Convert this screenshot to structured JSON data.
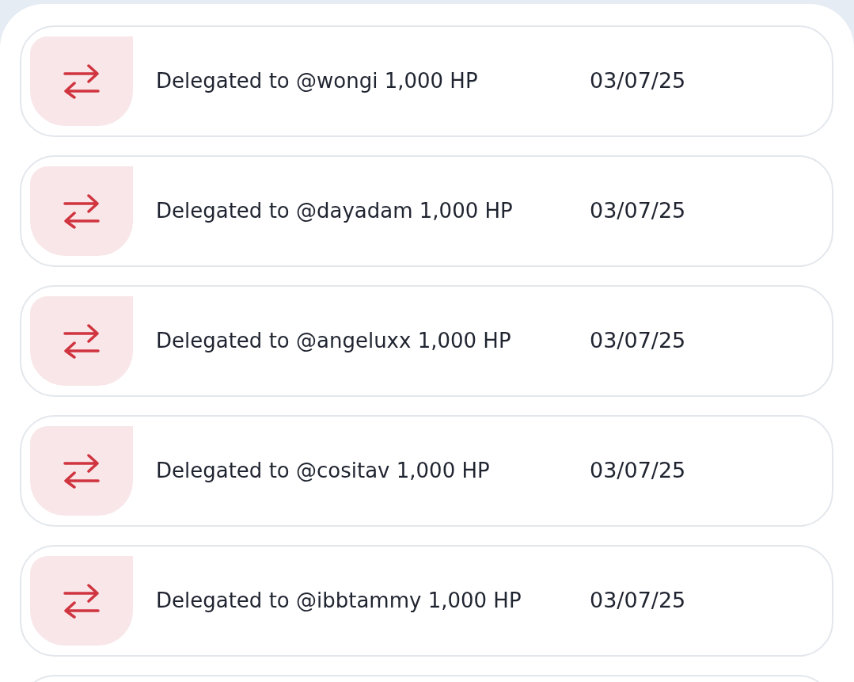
{
  "transactions": [
    {
      "kind": "delegation",
      "description": "Delegated to @wongi 1,000 HP",
      "date": "03/07/25"
    },
    {
      "kind": "delegation",
      "description": "Delegated to @dayadam 1,000 HP",
      "date": "03/07/25"
    },
    {
      "kind": "delegation",
      "description": "Delegated to @angeluxx 1,000 HP",
      "date": "03/07/25"
    },
    {
      "kind": "delegation",
      "description": "Delegated to @cositav 1,000 HP",
      "date": "03/07/25"
    },
    {
      "kind": "delegation",
      "description": "Delegated to @ibbtammy 1,000 HP",
      "date": "03/07/25"
    }
  ]
}
